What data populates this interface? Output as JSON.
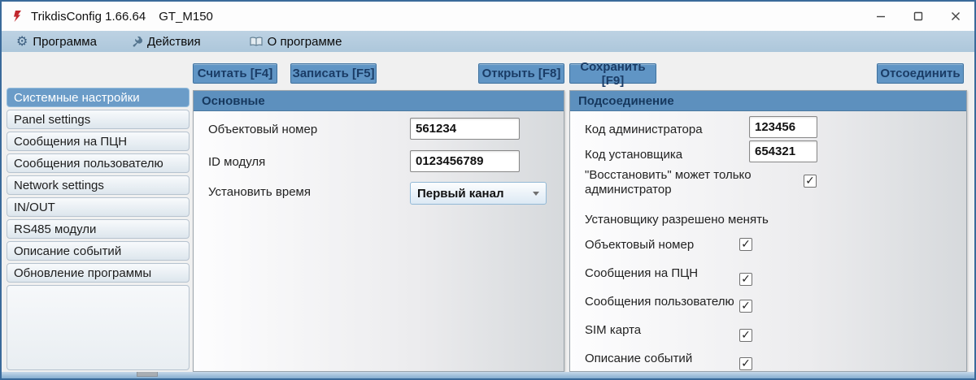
{
  "titlebar": {
    "app": "TrikdisConfig 1.66.64",
    "device": "GT_M150"
  },
  "menubar": {
    "program": "Программа",
    "actions": "Действия",
    "about": "О программе"
  },
  "toolbar": {
    "read": "Считать [F4]",
    "write": "Записать [F5]",
    "open": "Открыть [F8]",
    "save": "Сохранить [F9]",
    "disconnect": "Отсоединить"
  },
  "sidebar": {
    "items": [
      {
        "label": "Системные настройки",
        "selected": true
      },
      {
        "label": "Panel settings",
        "selected": false
      },
      {
        "label": "Сообщения на ПЦН",
        "selected": false
      },
      {
        "label": "Сообщения пользователю",
        "selected": false
      },
      {
        "label": "Network settings",
        "selected": false
      },
      {
        "label": "IN/OUT",
        "selected": false
      },
      {
        "label": "RS485 модули",
        "selected": false
      },
      {
        "label": "Описание событий",
        "selected": false
      },
      {
        "label": "Обновление программы",
        "selected": false
      }
    ]
  },
  "basic": {
    "title": "Основные",
    "object_number": {
      "label": "Объектовый номер",
      "value": "561234"
    },
    "module_id": {
      "label": "ID модуля",
      "value": "0123456789"
    },
    "set_time": {
      "label": "Установить время",
      "value": "Первый канал"
    }
  },
  "connection": {
    "title": "Подсоединение",
    "admin_code": {
      "label": "Код администратора",
      "value": "123456"
    },
    "installer_code": {
      "label": "Код установщика",
      "value": "654321"
    },
    "restore_admin_only": {
      "label": "\"Восстановить\" может только администратор",
      "checked": true
    },
    "installer_heading": "Установщику разрешено менять",
    "permissions": [
      {
        "label": "Объектовый номер",
        "checked": true
      },
      {
        "label": "Сообщения на ПЦН",
        "checked": true
      },
      {
        "label": "Сообщения пользователю",
        "checked": true
      },
      {
        "label": "SIM карта",
        "checked": true
      },
      {
        "label": "Описание событий",
        "checked": true
      }
    ]
  },
  "colors": {
    "accent_header": "#5d90be",
    "menubar": "#b4cbdd",
    "button": "#6095c5",
    "selected_item": "#6b9cc8",
    "window_border": "#3a6a9a",
    "logo_red": "#c1272d"
  }
}
